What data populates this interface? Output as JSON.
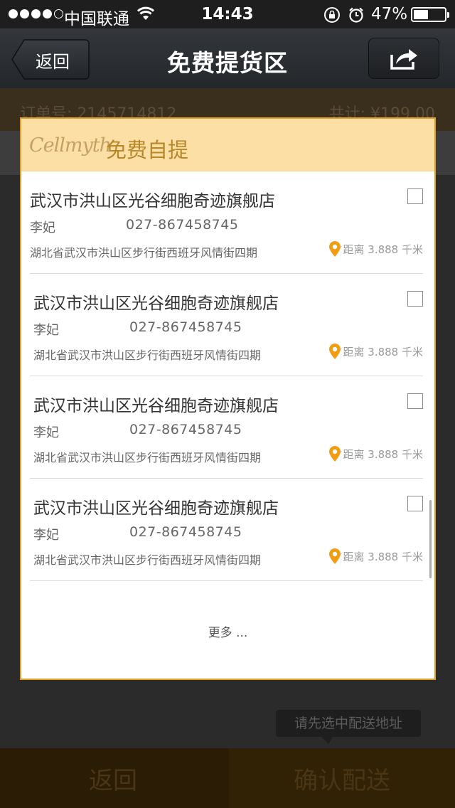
{
  "status_bar": {
    "carrier": "中国联通",
    "time": "14:43",
    "battery_percent": "47%",
    "battery_level": 0.47,
    "signal_bars_filled": 4,
    "signal_bars_total": 5,
    "icons": [
      "wifi-icon",
      "rotation-lock-icon",
      "alarm-icon",
      "battery-icon"
    ]
  },
  "nav": {
    "back_label": "返回",
    "title": "免费提货区",
    "share_icon": "share-icon"
  },
  "background": {
    "order_number": "订单号: 2145714812",
    "order_total": "共计: ¥199.00",
    "bottom_back": "返回",
    "bottom_confirm": "确认配送",
    "toast": "请先选中配送地址"
  },
  "dialog": {
    "brand": "Cellmyth",
    "title": "免费自提",
    "stores": [
      {
        "name": "武汉市洪山区光谷细胞奇迹旗舰店",
        "contact": "李妃",
        "phone": "027-867458745",
        "address": "湖北省武汉市洪山区步行街西班牙风情街四期",
        "distance": "距离 3.888 千米",
        "checked": false
      },
      {
        "name": "武汉市洪山区光谷细胞奇迹旗舰店",
        "contact": "李妃",
        "phone": "027-867458745",
        "address": "湖北省武汉市洪山区步行街西班牙风情街四期",
        "distance": "距离 3.888 千米",
        "checked": false
      },
      {
        "name": "武汉市洪山区光谷细胞奇迹旗舰店",
        "contact": "李妃",
        "phone": "027-867458745",
        "address": "湖北省武汉市洪山区步行街西班牙风情街四期",
        "distance": "距离 3.888 千米",
        "checked": false
      },
      {
        "name": "武汉市洪山区光谷细胞奇迹旗舰店",
        "contact": "李妃",
        "phone": "027-867458745",
        "address": "湖北省武汉市洪山区步行街西班牙风情街四期",
        "distance": "距离 3.888 千米",
        "checked": false
      }
    ],
    "more_label": "更多 ..."
  },
  "colors": {
    "accent": "#e0a12a",
    "header_bg": "#fbdfa4",
    "title_gold": "#b98728",
    "pin_orange": "#f39c12"
  }
}
